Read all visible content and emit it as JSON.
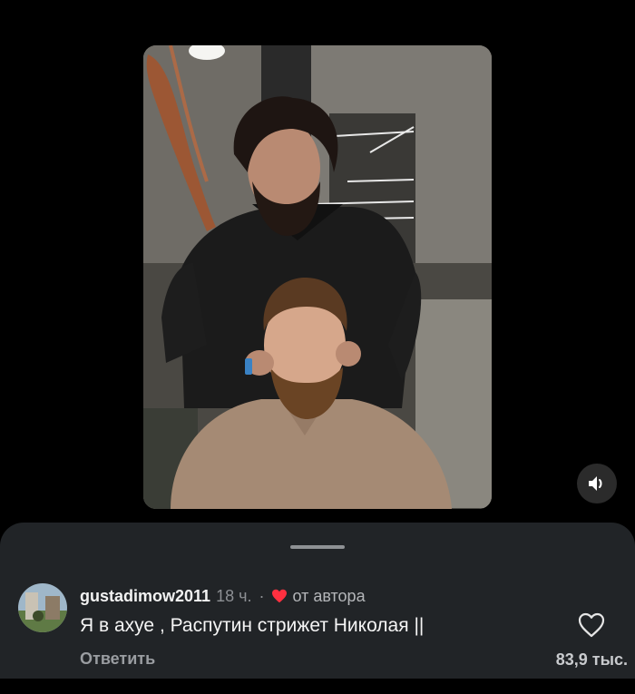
{
  "video": {
    "mute_icon": "speaker-icon"
  },
  "comment": {
    "username": "gustadimow2011",
    "time": "18 ч.",
    "separator": "·",
    "author_like_icon": "heart-filled-icon",
    "author_like_label": "от автора",
    "text": "Я в ахуе , Распутин стрижет Николая ||",
    "reply_label": "Ответить",
    "like_icon": "heart-outline-icon",
    "like_count": "83,9 тыс.",
    "colors": {
      "author_heart": "#ff3040",
      "sheet_background": "#212427"
    }
  }
}
